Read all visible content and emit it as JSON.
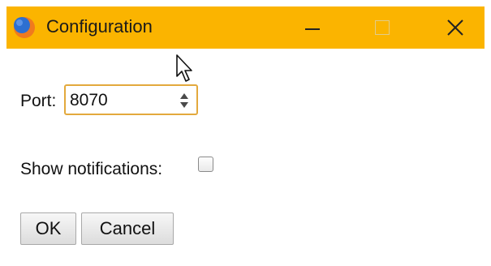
{
  "window": {
    "title": "Configuration",
    "accent_color": "#fbb400",
    "icons": {
      "app": "app-logo-icon",
      "minimize": "minimize-icon",
      "maximize": "maximize-icon",
      "close": "close-icon"
    }
  },
  "form": {
    "port": {
      "label": "Port:",
      "value": "8070",
      "spinner_icon": "spinner-arrows-icon"
    },
    "notifications": {
      "label": "Show notifications:",
      "checked": false
    }
  },
  "buttons": {
    "ok": "OK",
    "cancel": "Cancel"
  }
}
